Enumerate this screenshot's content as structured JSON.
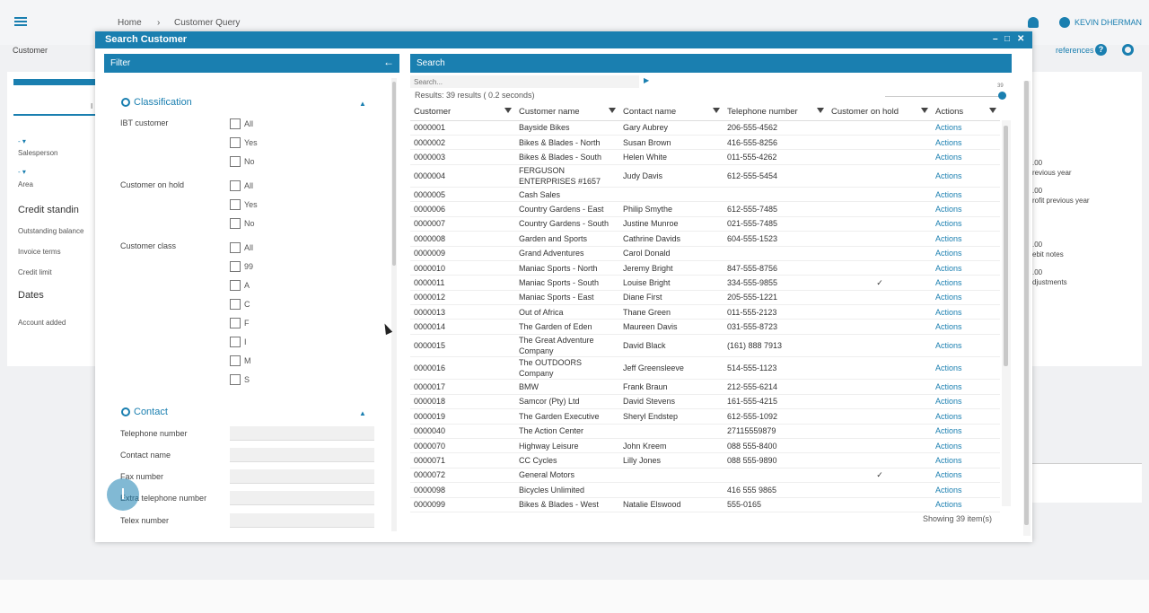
{
  "app": {
    "breadcrumb": [
      "Home",
      "Customer Query"
    ],
    "breadcrumb_sep": "›",
    "user": "KEVIN DHERMAN",
    "subbar_label": "Customer",
    "preferences": "references ▾",
    "help": "?"
  },
  "bg_left": {
    "salesperson_value": "-  ▾",
    "salesperson": "Salesperson",
    "area_value": "-  ▾",
    "area": "Area",
    "credit_heading": "Credit standin",
    "outstanding": "Outstanding balance",
    "invoice_terms": "Invoice terms",
    "credit_limit": "Credit limit",
    "dates_heading": "Dates",
    "account_added": "Account added",
    "tab_marker": "I"
  },
  "bg_right": {
    "v1": ".00",
    "l1": "revious year",
    "v2": ".00",
    "l2": "rofit previous year",
    "v3": ".00",
    "l3": "ebit notes",
    "v4": ".00",
    "l4": "djustments"
  },
  "modal": {
    "title": "Search Customer",
    "minimize": "–",
    "maximize": "□",
    "close": "✕"
  },
  "filter": {
    "heading": "Filter",
    "back_icon": "←",
    "classification": {
      "title": "Classification",
      "ibt_label": "IBT customer",
      "ibt_options": [
        "All",
        "Yes",
        "No"
      ],
      "hold_label": "Customer on hold",
      "hold_options": [
        "All",
        "Yes",
        "No"
      ],
      "class_label": "Customer class",
      "class_options": [
        "All",
        "99",
        "A",
        "C",
        "F",
        "I",
        "M",
        "S"
      ]
    },
    "contact": {
      "title": "Contact",
      "fields": [
        "Telephone number",
        "Contact name",
        "Fax number",
        "Extra telephone number",
        "Telex number"
      ]
    }
  },
  "search": {
    "heading": "Search",
    "placeholder": "Search...",
    "results": "Results: 39 results ( 0.2 seconds)",
    "slider_value": "39",
    "slider_fraction": 0.95,
    "showing": "Showing 39 item(s)"
  },
  "table": {
    "columns": [
      "Customer",
      "Customer name",
      "Contact name",
      "Telephone number",
      "Customer on hold",
      "Actions"
    ],
    "action_label": "Actions",
    "hold_mark": "✓",
    "rows": [
      {
        "customer": "0000001",
        "name": "Bayside Bikes",
        "contact": "Gary Aubrey",
        "phone": "206-555-4562",
        "hold": false
      },
      {
        "customer": "0000002",
        "name": "Bikes & Blades - North",
        "contact": "Susan Brown",
        "phone": "416-555-8256",
        "hold": false
      },
      {
        "customer": "0000003",
        "name": "Bikes & Blades - South",
        "contact": "Helen White",
        "phone": "011-555-4262",
        "hold": false
      },
      {
        "customer": "0000004",
        "name": "FERGUSON ENTERPRISES #1657",
        "contact": "Judy Davis",
        "phone": "612-555-5454",
        "hold": false,
        "tall": true
      },
      {
        "customer": "0000005",
        "name": "Cash Sales",
        "contact": "",
        "phone": "",
        "hold": false
      },
      {
        "customer": "0000006",
        "name": "Country Gardens - East",
        "contact": "Philip Smythe",
        "phone": "612-555-7485",
        "hold": false
      },
      {
        "customer": "0000007",
        "name": "Country Gardens - South",
        "contact": "Justine Munroe",
        "phone": "021-555-7485",
        "hold": false
      },
      {
        "customer": "0000008",
        "name": "Garden and Sports",
        "contact": "Cathrine Davids",
        "phone": "604-555-1523",
        "hold": false
      },
      {
        "customer": "0000009",
        "name": "Grand Adventures",
        "contact": "Carol Donald",
        "phone": "",
        "hold": false
      },
      {
        "customer": "0000010",
        "name": "Maniac Sports - North",
        "contact": "Jeremy Bright",
        "phone": "847-555-8756",
        "hold": false
      },
      {
        "customer": "0000011",
        "name": "Maniac Sports - South",
        "contact": "Louise Bright",
        "phone": "334-555-9855",
        "hold": true
      },
      {
        "customer": "0000012",
        "name": "Maniac Sports - East",
        "contact": "Diane First",
        "phone": "205-555-1221",
        "hold": false
      },
      {
        "customer": "0000013",
        "name": "Out of Africa",
        "contact": "Thane Green",
        "phone": "011-555-2123",
        "hold": false
      },
      {
        "customer": "0000014",
        "name": "The Garden of Eden",
        "contact": "Maureen Davis",
        "phone": "031-555-8723",
        "hold": false
      },
      {
        "customer": "0000015",
        "name": "The Great Adventure Company",
        "contact": "David Black",
        "phone": "(161) 888 7913",
        "hold": false,
        "tall": true
      },
      {
        "customer": "0000016",
        "name": "The OUTDOORS Company",
        "contact": "Jeff Greensleeve",
        "phone": "514-555-1123",
        "hold": false
      },
      {
        "customer": "0000017",
        "name": "BMW",
        "contact": "Frank Braun",
        "phone": "212-555-6214",
        "hold": false
      },
      {
        "customer": "0000018",
        "name": "Samcor (Pty) Ltd",
        "contact": "David Stevens",
        "phone": "161-555-4215",
        "hold": false
      },
      {
        "customer": "0000019",
        "name": "The Garden Executive",
        "contact": "Sheryl Endstep",
        "phone": "612-555-1092",
        "hold": false
      },
      {
        "customer": "0000040",
        "name": "The Action Center",
        "contact": "",
        "phone": "27115559879",
        "hold": false
      },
      {
        "customer": "0000070",
        "name": "Highway Leisure",
        "contact": "John Kreem",
        "phone": "088 555-8400",
        "hold": false
      },
      {
        "customer": "0000071",
        "name": "CC Cycles",
        "contact": "Lilly Jones",
        "phone": "088 555-9890",
        "hold": false
      },
      {
        "customer": "0000072",
        "name": "General Motors",
        "contact": "",
        "phone": "",
        "hold": true
      },
      {
        "customer": "0000098",
        "name": "Bicycles Unlimited",
        "contact": "",
        "phone": "416 555 9865",
        "hold": false
      },
      {
        "customer": "0000099",
        "name": "Bikes & Blades - West",
        "contact": "Natalie Elswood",
        "phone": "555-0165",
        "hold": false
      }
    ]
  },
  "colors": {
    "accent": "#1a7fb0"
  }
}
